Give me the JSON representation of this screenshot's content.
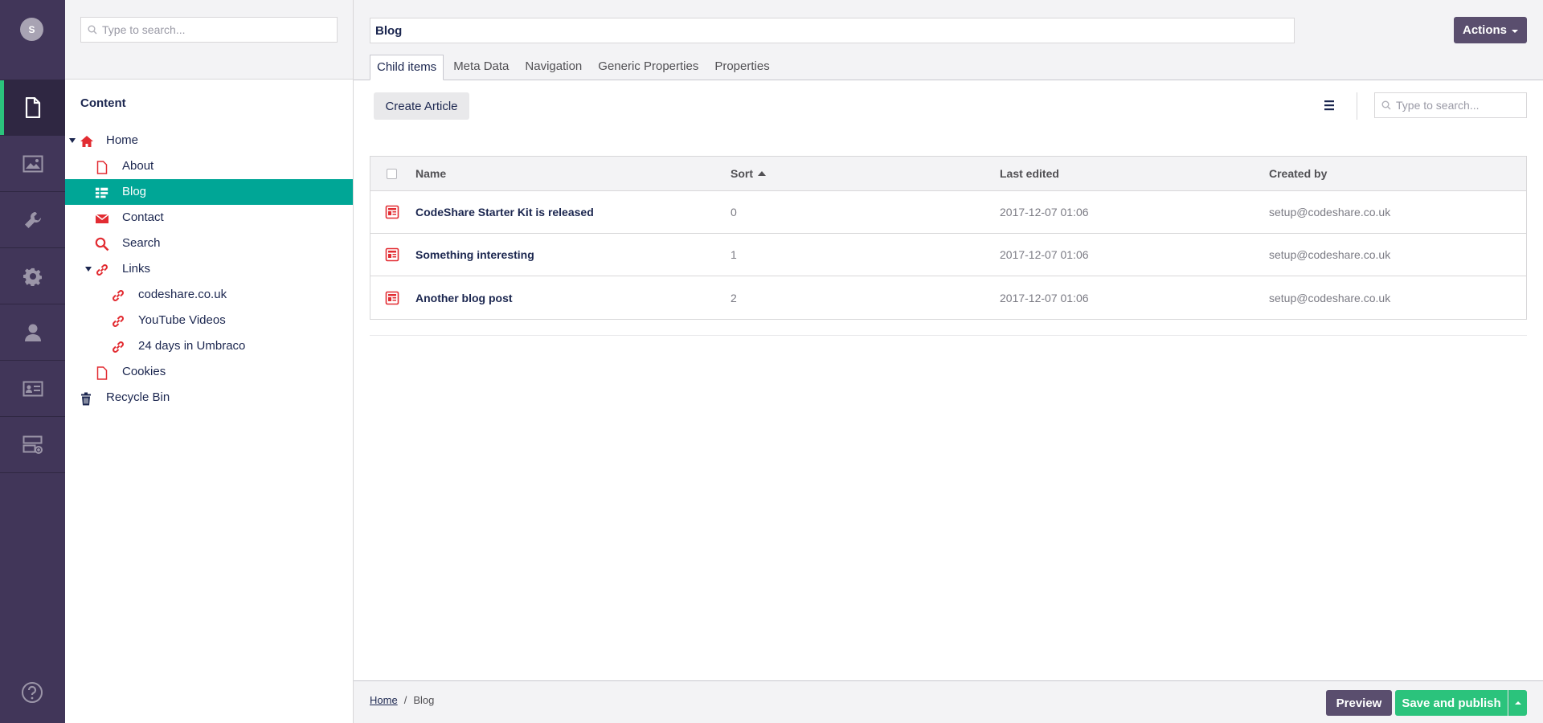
{
  "user": {
    "initial": "S"
  },
  "rail": {
    "sections": [
      {
        "name": "content",
        "icon": "document-icon"
      },
      {
        "name": "media",
        "icon": "image-icon"
      },
      {
        "name": "settings",
        "icon": "wrench-icon"
      },
      {
        "name": "developer",
        "icon": "gear-icon"
      },
      {
        "name": "users",
        "icon": "user-icon"
      },
      {
        "name": "members",
        "icon": "id-card-icon"
      },
      {
        "name": "forms",
        "icon": "server-icon"
      }
    ]
  },
  "tree": {
    "search_placeholder": "Type to search...",
    "title": "Content",
    "nodes": [
      {
        "label": "Home"
      },
      {
        "label": "About"
      },
      {
        "label": "Blog"
      },
      {
        "label": "Contact"
      },
      {
        "label": "Search"
      },
      {
        "label": "Links"
      },
      {
        "label": "codeshare.co.uk"
      },
      {
        "label": "YouTube Videos"
      },
      {
        "label": "24 days in Umbraco"
      },
      {
        "label": "Cookies"
      },
      {
        "label": "Recycle Bin"
      }
    ]
  },
  "editor": {
    "name_value": "Blog",
    "actions_label": "Actions",
    "tabs": [
      {
        "label": "Child items"
      },
      {
        "label": "Meta Data"
      },
      {
        "label": "Navigation"
      },
      {
        "label": "Generic Properties"
      },
      {
        "label": "Properties"
      }
    ],
    "create_label": "Create Article",
    "list_search_placeholder": "Type to search...",
    "columns": {
      "name": "Name",
      "sort": "Sort",
      "last_edited": "Last edited",
      "created_by": "Created by"
    },
    "rows": [
      {
        "name": "CodeShare Starter Kit is released",
        "sort": "0",
        "last_edited": "2017-12-07 01:06",
        "created_by": "setup@codeshare.co.uk"
      },
      {
        "name": "Something interesting",
        "sort": "1",
        "last_edited": "2017-12-07 01:06",
        "created_by": "setup@codeshare.co.uk"
      },
      {
        "name": "Another blog post",
        "sort": "2",
        "last_edited": "2017-12-07 01:06",
        "created_by": "setup@codeshare.co.uk"
      }
    ]
  },
  "footer": {
    "breadcrumb": [
      {
        "label": "Home"
      },
      {
        "label": "Blog"
      }
    ],
    "separator": "/",
    "preview_label": "Preview",
    "publish_label": "Save and publish"
  },
  "colors": {
    "rail_bg": "#413659",
    "selected_node": "#00a696",
    "publish_green": "#2bc37c",
    "icon_red": "#e22c32"
  }
}
